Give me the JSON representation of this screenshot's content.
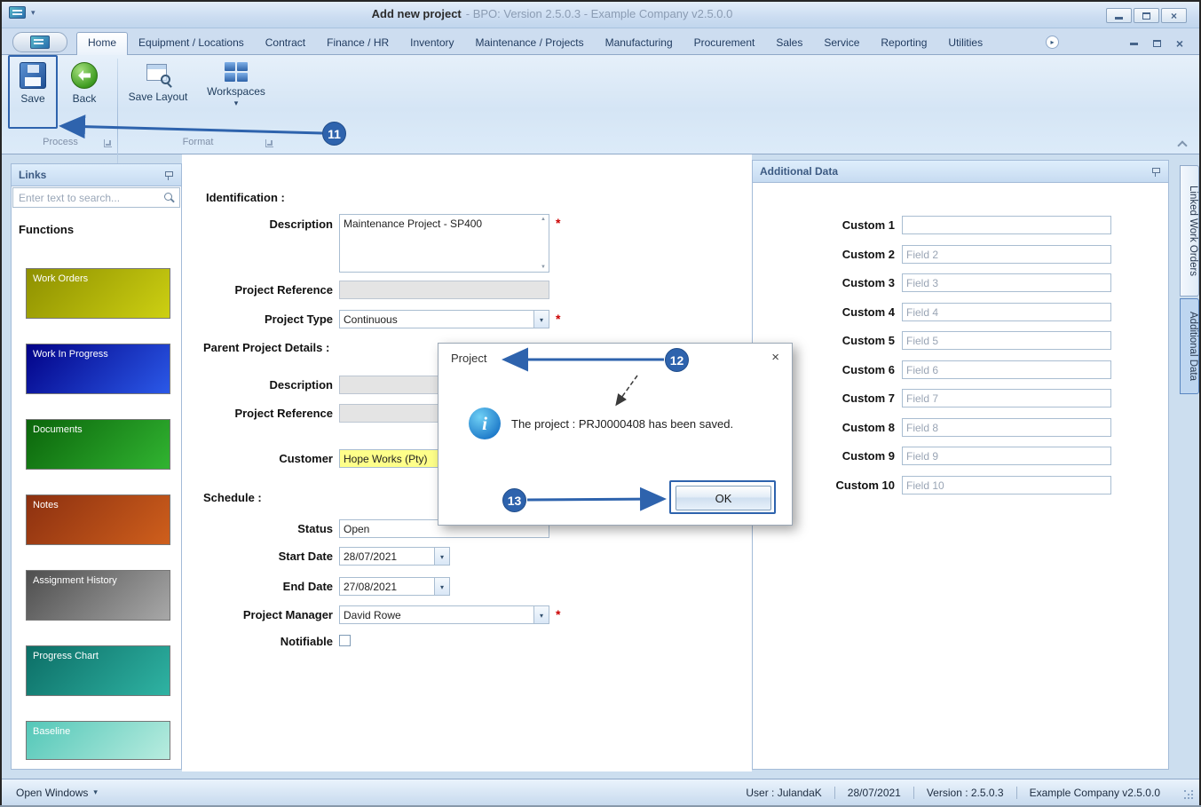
{
  "colors": {
    "accent": "#2e63ad",
    "required_marker_color": "#cc0000",
    "customer_field_highlight": "#feff8a"
  },
  "icons": {
    "caret_down": "▾",
    "close": "×",
    "scroll_right": "▸",
    "scroll_up": "▲",
    "scroll_down": "▼",
    "info": "i",
    "pin": "css-shape",
    "search": "css-shape"
  },
  "window": {
    "title": "Add new project",
    "subtitle": "- BPO: Version 2.5.0.3 - Example Company v2.5.0.0"
  },
  "ribbon": {
    "tabs": [
      "Home",
      "Equipment / Locations",
      "Contract",
      "Finance / HR",
      "Inventory",
      "Maintenance / Projects",
      "Manufacturing",
      "Procurement",
      "Sales",
      "Service",
      "Reporting",
      "Utilities"
    ],
    "active_tab": "Home",
    "buttons": {
      "save": "Save",
      "back": "Back",
      "save_layout": "Save Layout",
      "workspaces": "Workspaces"
    },
    "groups": {
      "process": "Process",
      "format": "Format"
    }
  },
  "links_panel": {
    "title": "Links",
    "search_placeholder": "Enter text to search...",
    "heading": "Functions",
    "items": [
      {
        "label": "Work Orders",
        "color_from": "#8e9000",
        "color_to": "#cdd012"
      },
      {
        "label": "Work In Progress",
        "color_from": "#020287",
        "color_to": "#2b59e8"
      },
      {
        "label": "Documents",
        "color_from": "#0b650b",
        "color_to": "#31b431"
      },
      {
        "label": "Notes",
        "color_from": "#8c3010",
        "color_to": "#cf5f1c"
      },
      {
        "label": "Assignment History",
        "color_from": "#4e4e4e",
        "color_to": "#a8a8a8"
      },
      {
        "label": "Progress Chart",
        "color_from": "#0c6e66",
        "color_to": "#2fb3a3"
      },
      {
        "label": "Baseline",
        "color_from": "#53c7b8",
        "color_to": "#b8ecdf"
      }
    ]
  },
  "form": {
    "section_identification": "Identification :",
    "description_label": "Description",
    "description_value": "Maintenance Project - SP400",
    "project_reference_label": "Project Reference",
    "project_reference_value": "",
    "project_type_label": "Project Type",
    "project_type_value": "Continuous",
    "section_parent": "Parent Project Details :",
    "parent_description_label": "Description",
    "parent_description_value": "",
    "parent_reference_label": "Project Reference",
    "parent_reference_value": "",
    "customer_label": "Customer",
    "customer_value": "Hope Works (Pty)",
    "section_schedule": "Schedule :",
    "status_label": "Status",
    "status_value": "Open",
    "start_date_label": "Start Date",
    "start_date_value": "28/07/2021",
    "end_date_label": "End Date",
    "end_date_value": "27/08/2021",
    "project_manager_label": "Project Manager",
    "project_manager_value": "David Rowe",
    "notifiable_label": "Notifiable",
    "required_marker": "*"
  },
  "dialog": {
    "title": "Project",
    "message": "The project : PRJ0000408 has been saved.",
    "ok_label": "OK"
  },
  "additional_panel": {
    "title": "Additional Data",
    "fields": [
      {
        "label": "Custom 1",
        "value": "",
        "placeholder": ""
      },
      {
        "label": "Custom 2",
        "placeholder": "Field 2"
      },
      {
        "label": "Custom 3",
        "placeholder": "Field 3"
      },
      {
        "label": "Custom 4",
        "placeholder": "Field 4"
      },
      {
        "label": "Custom 5",
        "placeholder": "Field 5"
      },
      {
        "label": "Custom 6",
        "placeholder": "Field 6"
      },
      {
        "label": "Custom 7",
        "placeholder": "Field 7"
      },
      {
        "label": "Custom 8",
        "placeholder": "Field 8"
      },
      {
        "label": "Custom 9",
        "placeholder": "Field 9"
      },
      {
        "label": "Custom 10",
        "placeholder": "Field 10"
      }
    ]
  },
  "side_tabs": [
    {
      "label": "Linked Work Orders"
    },
    {
      "label": "Additional Data"
    }
  ],
  "status_bar": {
    "open_windows": "Open Windows",
    "user": "User : JulandaK",
    "date": "28/07/2021",
    "version": "Version : 2.5.0.3",
    "company": "Example Company v2.5.0.0"
  },
  "annotations": {
    "step11": "11",
    "step12": "12",
    "step13": "13"
  }
}
